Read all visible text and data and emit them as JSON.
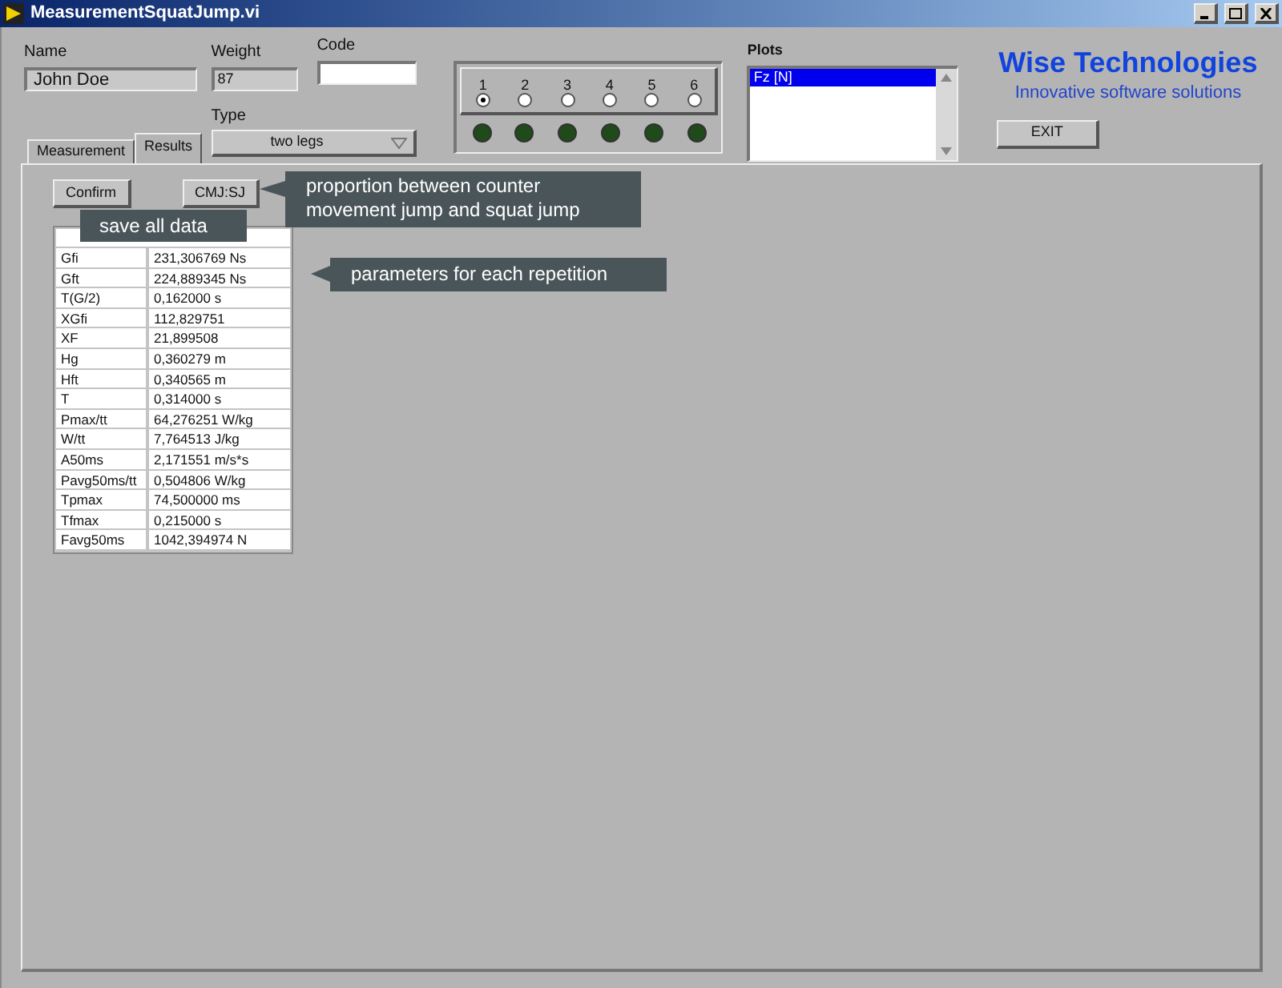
{
  "window": {
    "title": "MeasurementSquatJump.vi"
  },
  "name": {
    "label": "Name",
    "value": "John Doe"
  },
  "weight": {
    "label": "Weight",
    "value": "87"
  },
  "code": {
    "label": "Code"
  },
  "type": {
    "label": "Type",
    "value": "two legs"
  },
  "tabs": [
    {
      "label": "Measurement",
      "selected": false
    },
    {
      "label": "Results",
      "selected": true
    }
  ],
  "repetitions": [
    {
      "label": "1",
      "selected": true,
      "lamp_on": false
    },
    {
      "label": "2",
      "selected": false,
      "lamp_on": false
    },
    {
      "label": "3",
      "selected": false,
      "lamp_on": false
    },
    {
      "label": "4",
      "selected": false,
      "lamp_on": false
    },
    {
      "label": "5",
      "selected": false,
      "lamp_on": false
    },
    {
      "label": "6",
      "selected": false,
      "lamp_on": false
    }
  ],
  "plots": {
    "label": "Plots",
    "items": [
      {
        "label": "Fz [N]",
        "selected": true
      }
    ]
  },
  "brand": {
    "name": "Wise Technologies",
    "tagline": "Innovative software solutions"
  },
  "exit_button": "EXIT",
  "buttons": [
    "Confirm",
    "CMJ:SJ"
  ],
  "results": [
    {
      "parameter": "Gfi",
      "value": "231,306769 Ns"
    },
    {
      "parameter": "Gft",
      "value": "224,889345 Ns"
    },
    {
      "parameter": "T(G/2)",
      "value": "0,162000 s"
    },
    {
      "parameter": "XGfi",
      "value": "112,829751"
    },
    {
      "parameter": "XF",
      "value": "21,899508"
    },
    {
      "parameter": "Hg",
      "value": "0,360279 m"
    },
    {
      "parameter": "Hft",
      "value": "0,340565 m"
    },
    {
      "parameter": "T",
      "value": "0,314000 s"
    },
    {
      "parameter": "Pmax/tt",
      "value": "64,276251 W/kg"
    },
    {
      "parameter": "W/tt",
      "value": "7,764513 J/kg"
    },
    {
      "parameter": "A50ms",
      "value": "2,171551 m/s*s"
    },
    {
      "parameter": "Pavg50ms/tt",
      "value": "0,504806 W/kg"
    },
    {
      "parameter": "Tpmax",
      "value": "74,500000 ms"
    },
    {
      "parameter": "Tfmax",
      "value": "0,215000 s"
    },
    {
      "parameter": "Favg50ms",
      "value": "1042,394974 N"
    }
  ],
  "callouts": [
    {
      "text": "save all data"
    },
    {
      "text": "proportion between counter movement jump and squat jump"
    },
    {
      "text": "parameters for each repetition"
    }
  ]
}
